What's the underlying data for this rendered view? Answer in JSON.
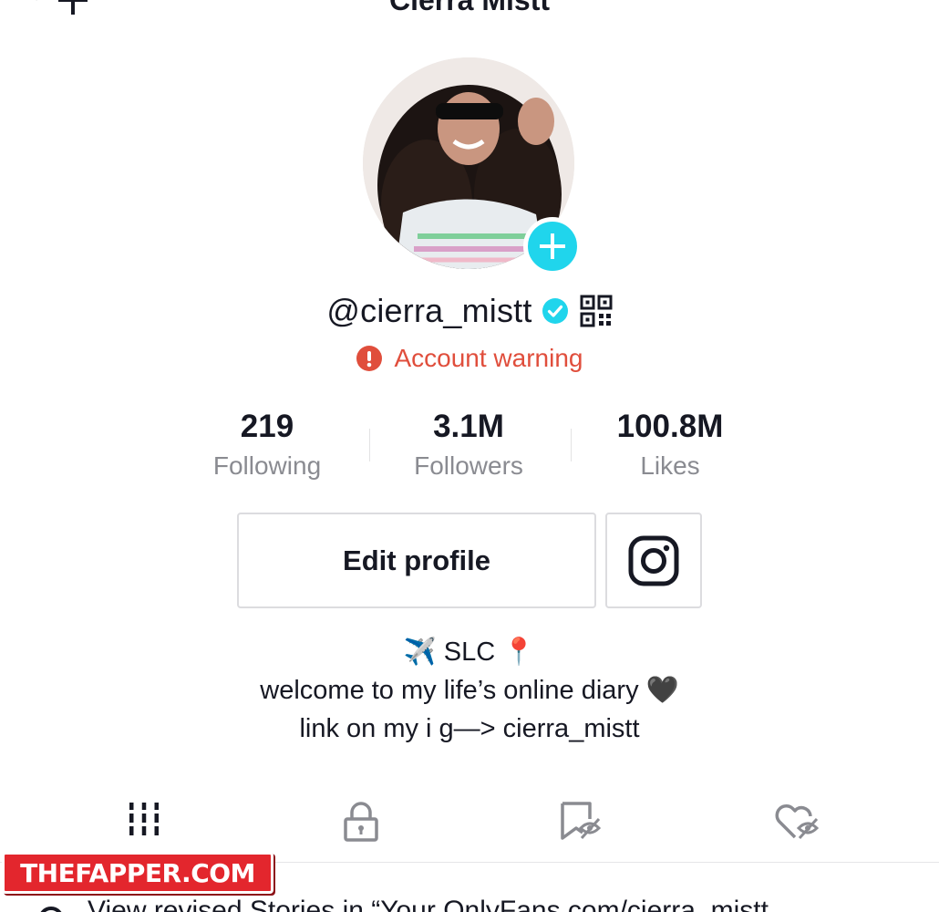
{
  "header": {
    "title": "Cierra Mistt"
  },
  "profile": {
    "handle": "@cierra_mistt",
    "warning": "Account warning"
  },
  "stats": [
    {
      "value": "219",
      "label": "Following"
    },
    {
      "value": "3.1M",
      "label": "Followers"
    },
    {
      "value": "100.8M",
      "label": "Likes"
    }
  ],
  "actions": {
    "edit_label": "Edit profile"
  },
  "bio": {
    "line1": "✈️ SLC 📍",
    "line2": "welcome to my life’s online diary 🖤",
    "line3": "link on my i g—> cierra_mistt"
  },
  "watermark": "THEFAPPER.COM",
  "story": {
    "text": "View revised Stories in “Your OnlyFans.com/cierra_mistt"
  },
  "colors": {
    "accent": "#20d5ec",
    "warning": "#e04e3c",
    "verified": "#20d5ec",
    "text": "#161823",
    "muted": "#8a8b91"
  },
  "icons": [
    "add-user-icon",
    "menu-icon",
    "verified-icon",
    "qr-code-icon",
    "warning-icon",
    "instagram-icon",
    "grid-icon",
    "lock-icon",
    "bookmark-hidden-icon",
    "heart-hidden-icon",
    "settings-icon"
  ]
}
